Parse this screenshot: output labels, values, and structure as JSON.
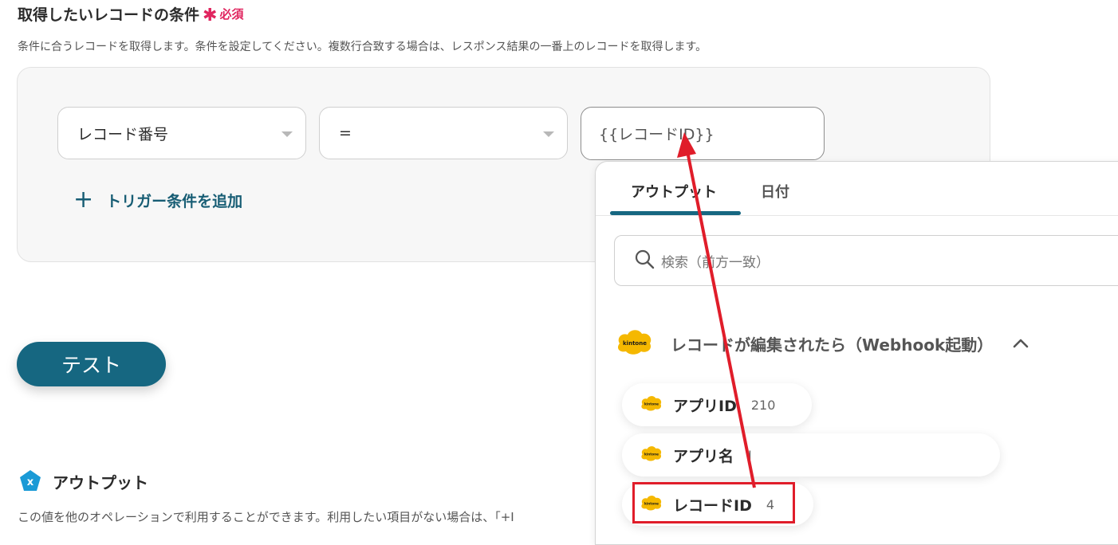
{
  "condition_section": {
    "title": "取得したいレコードの条件",
    "required_label": "必須",
    "description": "条件に合うレコードを取得します。条件を設定してください。複数行合致する場合は、レスポンス結果の一番上のレコードを取得します。",
    "field_select": "レコード番号",
    "operator_select": "=",
    "value_input": "{{レコードID}}",
    "add_condition_label": "トリガー条件を追加"
  },
  "test_button_label": "テスト",
  "output_section": {
    "title": "アウトプット",
    "description": "この値を他のオペレーションで利用することができます。利用したい項目がない場合は、「+I"
  },
  "popup": {
    "tabs": [
      {
        "label": "アウトプット",
        "active": true
      },
      {
        "label": "日付",
        "active": false
      }
    ],
    "search_placeholder": "検索（前方一致）",
    "group_title": "レコードが編集されたら（Webhook起動）",
    "items": [
      {
        "name": "アプリID",
        "value": "210"
      },
      {
        "name": "アプリ名",
        "value": "I"
      },
      {
        "name": "レコードID",
        "value": "4"
      }
    ]
  },
  "colors": {
    "accent": "#166781",
    "required": "#e0245e",
    "annotation": "#e01d2a",
    "kintone_logo": "#f5b800"
  }
}
